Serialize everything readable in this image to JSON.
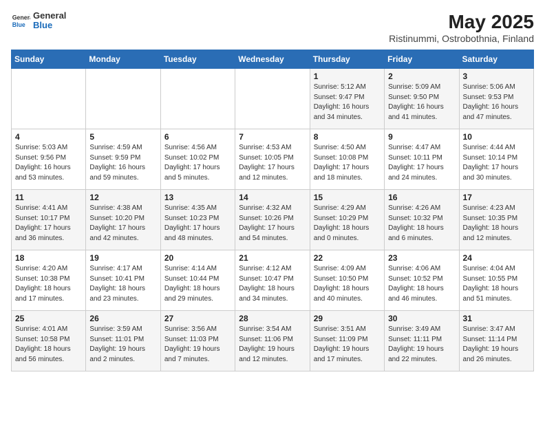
{
  "header": {
    "logo_general": "General",
    "logo_blue": "Blue",
    "title": "May 2025",
    "subtitle": "Ristinummi, Ostrobothnia, Finland"
  },
  "calendar": {
    "weekdays": [
      "Sunday",
      "Monday",
      "Tuesday",
      "Wednesday",
      "Thursday",
      "Friday",
      "Saturday"
    ],
    "weeks": [
      [
        {
          "day": "",
          "info": ""
        },
        {
          "day": "",
          "info": ""
        },
        {
          "day": "",
          "info": ""
        },
        {
          "day": "",
          "info": ""
        },
        {
          "day": "1",
          "info": "Sunrise: 5:12 AM\nSunset: 9:47 PM\nDaylight: 16 hours\nand 34 minutes."
        },
        {
          "day": "2",
          "info": "Sunrise: 5:09 AM\nSunset: 9:50 PM\nDaylight: 16 hours\nand 41 minutes."
        },
        {
          "day": "3",
          "info": "Sunrise: 5:06 AM\nSunset: 9:53 PM\nDaylight: 16 hours\nand 47 minutes."
        }
      ],
      [
        {
          "day": "4",
          "info": "Sunrise: 5:03 AM\nSunset: 9:56 PM\nDaylight: 16 hours\nand 53 minutes."
        },
        {
          "day": "5",
          "info": "Sunrise: 4:59 AM\nSunset: 9:59 PM\nDaylight: 16 hours\nand 59 minutes."
        },
        {
          "day": "6",
          "info": "Sunrise: 4:56 AM\nSunset: 10:02 PM\nDaylight: 17 hours\nand 5 minutes."
        },
        {
          "day": "7",
          "info": "Sunrise: 4:53 AM\nSunset: 10:05 PM\nDaylight: 17 hours\nand 12 minutes."
        },
        {
          "day": "8",
          "info": "Sunrise: 4:50 AM\nSunset: 10:08 PM\nDaylight: 17 hours\nand 18 minutes."
        },
        {
          "day": "9",
          "info": "Sunrise: 4:47 AM\nSunset: 10:11 PM\nDaylight: 17 hours\nand 24 minutes."
        },
        {
          "day": "10",
          "info": "Sunrise: 4:44 AM\nSunset: 10:14 PM\nDaylight: 17 hours\nand 30 minutes."
        }
      ],
      [
        {
          "day": "11",
          "info": "Sunrise: 4:41 AM\nSunset: 10:17 PM\nDaylight: 17 hours\nand 36 minutes."
        },
        {
          "day": "12",
          "info": "Sunrise: 4:38 AM\nSunset: 10:20 PM\nDaylight: 17 hours\nand 42 minutes."
        },
        {
          "day": "13",
          "info": "Sunrise: 4:35 AM\nSunset: 10:23 PM\nDaylight: 17 hours\nand 48 minutes."
        },
        {
          "day": "14",
          "info": "Sunrise: 4:32 AM\nSunset: 10:26 PM\nDaylight: 17 hours\nand 54 minutes."
        },
        {
          "day": "15",
          "info": "Sunrise: 4:29 AM\nSunset: 10:29 PM\nDaylight: 18 hours\nand 0 minutes."
        },
        {
          "day": "16",
          "info": "Sunrise: 4:26 AM\nSunset: 10:32 PM\nDaylight: 18 hours\nand 6 minutes."
        },
        {
          "day": "17",
          "info": "Sunrise: 4:23 AM\nSunset: 10:35 PM\nDaylight: 18 hours\nand 12 minutes."
        }
      ],
      [
        {
          "day": "18",
          "info": "Sunrise: 4:20 AM\nSunset: 10:38 PM\nDaylight: 18 hours\nand 17 minutes."
        },
        {
          "day": "19",
          "info": "Sunrise: 4:17 AM\nSunset: 10:41 PM\nDaylight: 18 hours\nand 23 minutes."
        },
        {
          "day": "20",
          "info": "Sunrise: 4:14 AM\nSunset: 10:44 PM\nDaylight: 18 hours\nand 29 minutes."
        },
        {
          "day": "21",
          "info": "Sunrise: 4:12 AM\nSunset: 10:47 PM\nDaylight: 18 hours\nand 34 minutes."
        },
        {
          "day": "22",
          "info": "Sunrise: 4:09 AM\nSunset: 10:50 PM\nDaylight: 18 hours\nand 40 minutes."
        },
        {
          "day": "23",
          "info": "Sunrise: 4:06 AM\nSunset: 10:52 PM\nDaylight: 18 hours\nand 46 minutes."
        },
        {
          "day": "24",
          "info": "Sunrise: 4:04 AM\nSunset: 10:55 PM\nDaylight: 18 hours\nand 51 minutes."
        }
      ],
      [
        {
          "day": "25",
          "info": "Sunrise: 4:01 AM\nSunset: 10:58 PM\nDaylight: 18 hours\nand 56 minutes."
        },
        {
          "day": "26",
          "info": "Sunrise: 3:59 AM\nSunset: 11:01 PM\nDaylight: 19 hours\nand 2 minutes."
        },
        {
          "day": "27",
          "info": "Sunrise: 3:56 AM\nSunset: 11:03 PM\nDaylight: 19 hours\nand 7 minutes."
        },
        {
          "day": "28",
          "info": "Sunrise: 3:54 AM\nSunset: 11:06 PM\nDaylight: 19 hours\nand 12 minutes."
        },
        {
          "day": "29",
          "info": "Sunrise: 3:51 AM\nSunset: 11:09 PM\nDaylight: 19 hours\nand 17 minutes."
        },
        {
          "day": "30",
          "info": "Sunrise: 3:49 AM\nSunset: 11:11 PM\nDaylight: 19 hours\nand 22 minutes."
        },
        {
          "day": "31",
          "info": "Sunrise: 3:47 AM\nSunset: 11:14 PM\nDaylight: 19 hours\nand 26 minutes."
        }
      ]
    ]
  }
}
